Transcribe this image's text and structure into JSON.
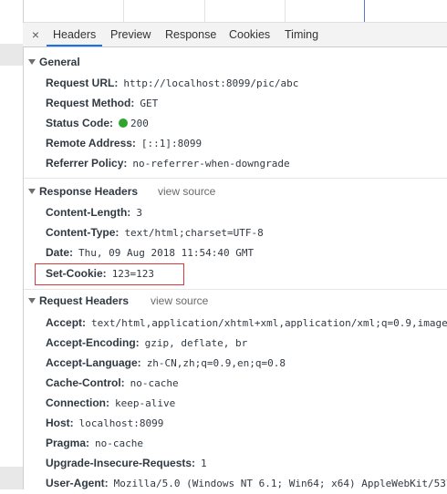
{
  "tabs": {
    "close_icon": "×",
    "items": [
      "Headers",
      "Preview",
      "Response",
      "Cookies",
      "Timing"
    ],
    "active": "Headers"
  },
  "general": {
    "title": "General",
    "rows": [
      {
        "key": "Request URL:",
        "value": "http://localhost:8099/pic/abc"
      },
      {
        "key": "Request Method:",
        "value": "GET"
      },
      {
        "key": "Status Code:",
        "value": "200"
      },
      {
        "key": "Remote Address:",
        "value": "[::1]:8099"
      },
      {
        "key": "Referrer Policy:",
        "value": "no-referrer-when-downgrade"
      }
    ]
  },
  "response_headers": {
    "title": "Response Headers",
    "view_source": "view source",
    "rows": [
      {
        "key": "Content-Length:",
        "value": "3"
      },
      {
        "key": "Content-Type:",
        "value": "text/html;charset=UTF-8"
      },
      {
        "key": "Date:",
        "value": "Thu, 09 Aug 2018 11:54:40 GMT"
      },
      {
        "key": "Set-Cookie:",
        "value": "123=123"
      }
    ]
  },
  "request_headers": {
    "title": "Request Headers",
    "view_source": "view source",
    "rows": [
      {
        "key": "Accept:",
        "value": "text/html,application/xhtml+xml,application/xml;q=0.9,image/"
      },
      {
        "key": "Accept-Encoding:",
        "value": "gzip, deflate, br"
      },
      {
        "key": "Accept-Language:",
        "value": "zh-CN,zh;q=0.9,en;q=0.8"
      },
      {
        "key": "Cache-Control:",
        "value": "no-cache"
      },
      {
        "key": "Connection:",
        "value": "keep-alive"
      },
      {
        "key": "Host:",
        "value": "localhost:8099"
      },
      {
        "key": "Pragma:",
        "value": "no-cache"
      },
      {
        "key": "Upgrade-Insecure-Requests:",
        "value": "1"
      },
      {
        "key": "User-Agent:",
        "value": "Mozilla/5.0 (Windows NT 6.1; Win64; x64) AppleWebKit/537"
      }
    ]
  },
  "colors": {
    "status_ok": "#2fa52f",
    "active_tab": "#1a73e8",
    "highlight": "#d93a3a"
  }
}
